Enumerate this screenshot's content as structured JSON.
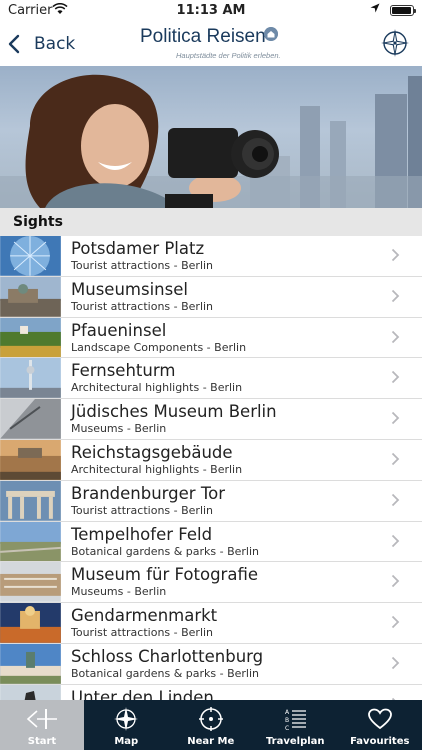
{
  "status_bar": {
    "carrier": "Carrier",
    "time": "11:13 AM"
  },
  "nav": {
    "back_label": "Back",
    "brand": "Politica Reisen",
    "tagline": "Hauptstädte der Politik erleben."
  },
  "section": {
    "title": "Sights"
  },
  "sights": [
    {
      "title": "Potsdamer Platz",
      "subtitle": "Tourist attractions - Berlin"
    },
    {
      "title": "Museumsinsel",
      "subtitle": "Tourist attractions - Berlin"
    },
    {
      "title": "Pfaueninsel",
      "subtitle": "Landscape Components - Berlin"
    },
    {
      "title": "Fernsehturm",
      "subtitle": "Architectural highlights - Berlin"
    },
    {
      "title": "Jüdisches Museum Berlin",
      "subtitle": "Museums - Berlin"
    },
    {
      "title": "Reichstagsgebäude",
      "subtitle": "Architectural highlights - Berlin"
    },
    {
      "title": "Brandenburger Tor",
      "subtitle": "Tourist attractions - Berlin"
    },
    {
      "title": "Tempelhofer Feld",
      "subtitle": "Botanical gardens & parks - Berlin"
    },
    {
      "title": "Museum für Fotografie",
      "subtitle": "Museums - Berlin"
    },
    {
      "title": "Gendarmenmarkt",
      "subtitle": "Tourist attractions - Berlin"
    },
    {
      "title": "Schloss Charlottenburg",
      "subtitle": "Botanical gardens & parks - Berlin"
    },
    {
      "title": "Unter den Linden",
      "subtitle": ""
    }
  ],
  "tabs": [
    {
      "label": "Start",
      "icon": "start-icon",
      "active": true
    },
    {
      "label": "Map",
      "icon": "compass-icon",
      "active": false
    },
    {
      "label": "Near Me",
      "icon": "crosshair-icon",
      "active": false
    },
    {
      "label": "Travelplan",
      "icon": "abc-list-icon",
      "active": false
    },
    {
      "label": "Favourites",
      "icon": "heart-icon",
      "active": false
    }
  ],
  "colors": {
    "brand": "#1a3a5c",
    "tabbar": "#0d2233",
    "active_tab": "#b9bcc0",
    "section_bg": "#e6e6e6"
  }
}
